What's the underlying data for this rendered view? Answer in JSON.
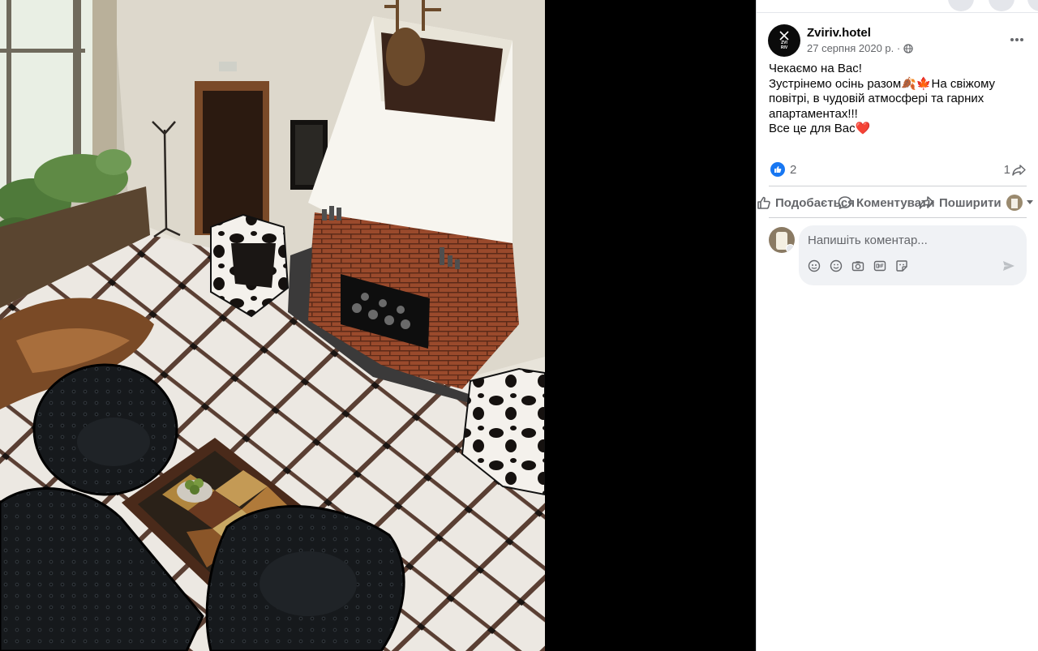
{
  "post": {
    "page_name": "Zviriv.hotel",
    "avatar_text_top": "ZVI",
    "avatar_text_bottom": "RIV",
    "date": "27 серпня 2020 р. ·",
    "text_lines": [
      "Чекаємо на Вас!",
      "Зустрінемо осінь разом🍂🍁На свіжому",
      "повітрі, в чудовій атмосфері та гарних",
      "апартаментах!!!",
      "Все це для Вас❤️"
    ],
    "reactions_count": "2",
    "shares_count": "1"
  },
  "actions": {
    "like": "Подобається",
    "comment": "Коментувати",
    "share": "Поширити"
  },
  "comment_box": {
    "placeholder": "Напишіть коментар..."
  },
  "icons": {
    "more": "more-horizontal-icon",
    "audience": "globe-icon",
    "like_reaction": "like-reaction-icon",
    "share_count": "share-arrow-icon",
    "avatar_emblem": "windmill-icon",
    "comment_tools": [
      "avatar-sticker-icon",
      "emoji-icon",
      "camera-icon",
      "gif-icon",
      "sticker-icon"
    ],
    "send": "send-icon"
  },
  "colors": {
    "facebook_blue": "#1877f2",
    "text_secondary": "#65676b",
    "comment_bg": "#f0f2f5",
    "heart_red": "#e0203a"
  }
}
